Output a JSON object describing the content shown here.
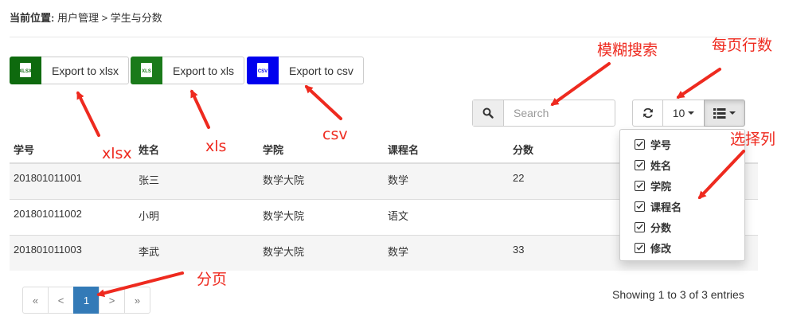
{
  "breadcrumb": {
    "label": "当前位置:",
    "path": "用户管理 > 学生与分数"
  },
  "exports": [
    {
      "label": "Export to xlsx",
      "icon_text": "XLSX",
      "color": "#0e6a0e"
    },
    {
      "label": "Export to xls",
      "icon_text": "XLS",
      "color": "#1a7a1a"
    },
    {
      "label": "Export to csv",
      "icon_text": "CSV",
      "color": "#0000ee"
    }
  ],
  "search": {
    "placeholder": "Search",
    "icon": "search-icon"
  },
  "toolbar": {
    "refresh_icon": "refresh-icon",
    "page_size": "10",
    "columns_icon": "list-icon"
  },
  "table": {
    "headers": [
      "学号",
      "姓名",
      "学院",
      "课程名",
      "分数"
    ],
    "rows": [
      [
        "201801011001",
        "张三",
        "数学大院",
        "数学",
        "22"
      ],
      [
        "201801011002",
        "小明",
        "数学大院",
        "语文",
        ""
      ],
      [
        "201801011003",
        "李武",
        "数学大院",
        "数学",
        "33"
      ]
    ]
  },
  "columns_menu": [
    "学号",
    "姓名",
    "学院",
    "课程名",
    "分数",
    "修改"
  ],
  "pagination": {
    "first": "«",
    "prev": "<",
    "current": "1",
    "next": ">",
    "last": "»"
  },
  "page_info": "Showing 1 to 3 of 3 entries",
  "annotations": {
    "xlsx": "xlsx",
    "xls": "xls",
    "csv": "csv",
    "search": "模糊搜索",
    "rows_per_page": "每页行数",
    "select_columns": "选择列",
    "paging": "分页"
  },
  "colors": {
    "accent": "#337ab7",
    "annotation": "#ee2a1f"
  }
}
